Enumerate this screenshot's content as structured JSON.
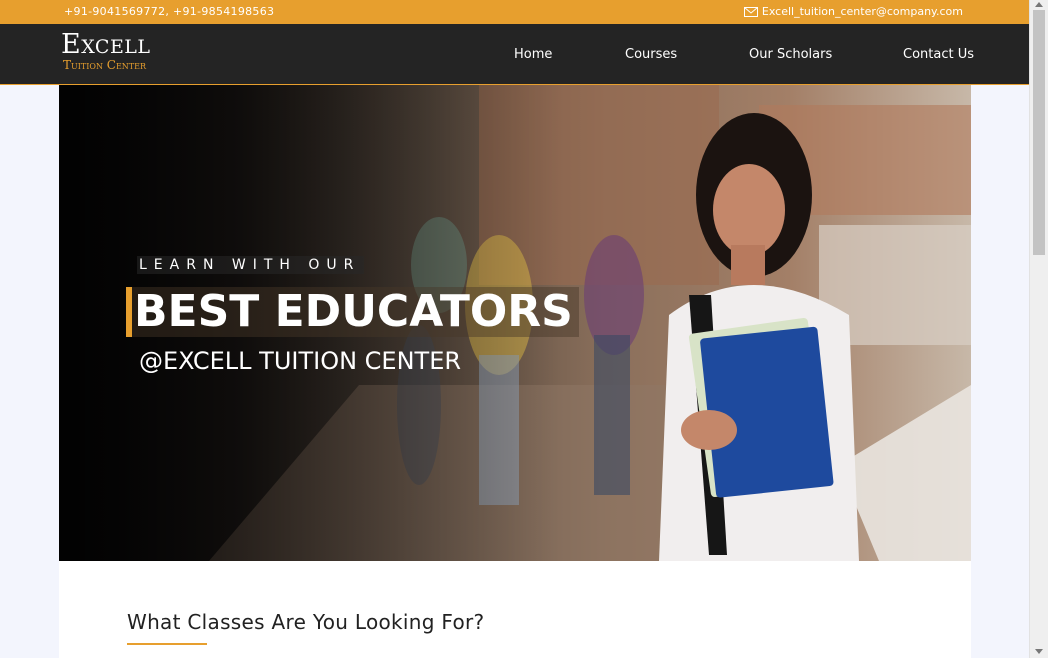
{
  "topbar": {
    "phones": "+91-9041569772, +91-9854198563",
    "email": "Excell_tuition_center@company.com",
    "email_icon": "mail-icon",
    "color": "#e79f2e"
  },
  "logo": {
    "line1": "Excell",
    "line2": "Tuition Center"
  },
  "nav": {
    "home": "Home",
    "courses": "Courses",
    "scholars": "Our Scholars",
    "contact": "Contact Us"
  },
  "hero": {
    "kicker": "LEARN WITH OUR",
    "headline": "BEST EDUCATORS",
    "subtitle": "@EXCELL TUITION CENTER"
  },
  "classes": {
    "heading": "What Classes Are You Looking For?"
  }
}
